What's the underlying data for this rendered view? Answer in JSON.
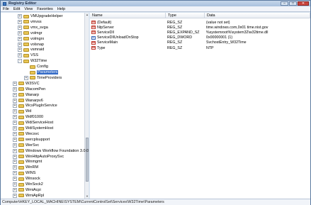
{
  "window": {
    "title": "Registry Editor"
  },
  "menu": [
    "File",
    "Edit",
    "View",
    "Favorites",
    "Help"
  ],
  "tree": [
    {
      "label": "VMUpgradeHelper",
      "expander": "+",
      "depth": 2
    },
    {
      "label": "vmvss",
      "expander": "+",
      "depth": 2
    },
    {
      "label": "vmx_svga",
      "expander": "+",
      "depth": 2
    },
    {
      "label": "volmgr",
      "expander": "+",
      "depth": 2
    },
    {
      "label": "volmgrx",
      "expander": "+",
      "depth": 2
    },
    {
      "label": "volsnap",
      "expander": "+",
      "depth": 2
    },
    {
      "label": "vsmraid",
      "expander": "+",
      "depth": 2
    },
    {
      "label": "VSS",
      "expander": "+",
      "depth": 2
    },
    {
      "label": "W32Time",
      "expander": "-",
      "depth": 2
    },
    {
      "label": "Config",
      "expander": "",
      "depth": 3
    },
    {
      "label": "Parameters",
      "expander": "",
      "depth": 3,
      "selected": true
    },
    {
      "label": "TimeProviders",
      "expander": "+",
      "depth": 3
    },
    {
      "label": "W3SVC",
      "expander": "+",
      "depth": 1
    },
    {
      "label": "WacomPen",
      "expander": "+",
      "depth": 1
    },
    {
      "label": "Wanarp",
      "expander": "+",
      "depth": 1
    },
    {
      "label": "Wanarpv6",
      "expander": "+",
      "depth": 1
    },
    {
      "label": "WcsPlugInService",
      "expander": "+",
      "depth": 1
    },
    {
      "label": "Wd",
      "expander": "+",
      "depth": 1
    },
    {
      "label": "Wdf01000",
      "expander": "+",
      "depth": 1
    },
    {
      "label": "WdiServiceHost",
      "expander": "+",
      "depth": 1
    },
    {
      "label": "WdiSystemHost",
      "expander": "+",
      "depth": 1
    },
    {
      "label": "Wecsvc",
      "expander": "+",
      "depth": 1
    },
    {
      "label": "wercplsupport",
      "expander": "+",
      "depth": 1
    },
    {
      "label": "WerSvc",
      "expander": "+",
      "depth": 1
    },
    {
      "label": "Windows Workflow Foundation 3.0.0.0",
      "expander": "+",
      "depth": 1
    },
    {
      "label": "WinHttpAutoProxySvc",
      "expander": "+",
      "depth": 1
    },
    {
      "label": "Winmgmt",
      "expander": "+",
      "depth": 1
    },
    {
      "label": "WinRM",
      "expander": "+",
      "depth": 1
    },
    {
      "label": "WINS",
      "expander": "+",
      "depth": 1
    },
    {
      "label": "Winsock",
      "expander": "+",
      "depth": 1
    },
    {
      "label": "WinSock2",
      "expander": "+",
      "depth": 1
    },
    {
      "label": "WmiAcpi",
      "expander": "+",
      "depth": 1
    },
    {
      "label": "WmiApRpl",
      "expander": "+",
      "depth": 1
    }
  ],
  "columns": {
    "name": "Name",
    "type": "Type",
    "data": "Data"
  },
  "values": [
    {
      "name": "(Default)",
      "type": "REG_SZ",
      "data": "(value not set)",
      "icon": "ab"
    },
    {
      "name": "NtpServer",
      "type": "REG_SZ",
      "data": "time.windows.com,0x01 time.nist.gov",
      "icon": "ab"
    },
    {
      "name": "ServiceDll",
      "type": "REG_EXPAND_SZ",
      "data": "%systemroot%\\system32\\w32time.dll",
      "icon": "ab"
    },
    {
      "name": "ServiceDllUnloadOnStop",
      "type": "REG_DWORD",
      "data": "0x00000001 (1)",
      "icon": "bin"
    },
    {
      "name": "ServiceMain",
      "type": "REG_SZ",
      "data": "SvchostEntry_W32Time",
      "icon": "ab"
    },
    {
      "name": "Type",
      "type": "REG_SZ",
      "data": "NTP",
      "icon": "ab"
    }
  ],
  "status": {
    "path": "Computer\\HKEY_LOCAL_MACHINE\\SYSTEM\\CurrentControlSet\\Services\\W32Time\\Parameters"
  }
}
